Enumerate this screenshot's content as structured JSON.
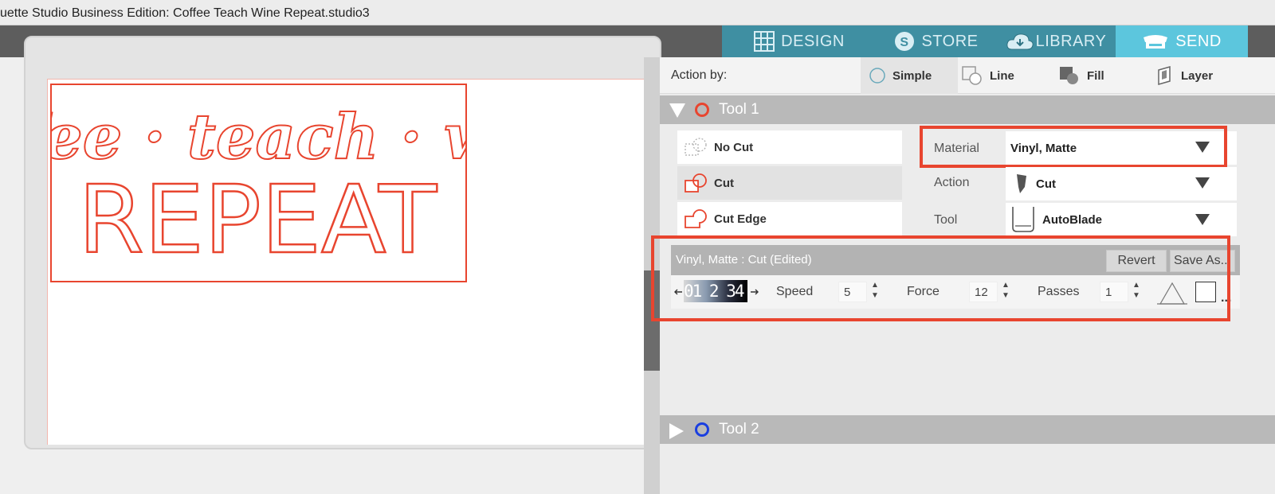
{
  "window": {
    "title": "uette Studio Business Edition: Coffee Teach Wine Repeat.studio3"
  },
  "nav": {
    "design": "DESIGN",
    "store": "STORE",
    "library": "LIBRARY",
    "send": "SEND"
  },
  "design": {
    "line1": "coffee · teach · wine",
    "line2": "REPEAT",
    "cut_color": "#e8452f"
  },
  "action_by": {
    "label": "Action by:",
    "options": [
      "Simple",
      "Line",
      "Fill",
      "Layer"
    ],
    "selected": "Simple"
  },
  "tool1": {
    "name": "Tool 1",
    "ring_color": "#e8452f",
    "cut_options": [
      "No Cut",
      "Cut",
      "Cut Edge"
    ],
    "selected_cut": "Cut",
    "material_label": "Material",
    "material_value": "Vinyl, Matte",
    "action_label": "Action",
    "action_value": "Cut",
    "tool_label": "Tool",
    "tool_value": "AutoBlade"
  },
  "settings": {
    "title": "Vinyl, Matte : Cut (Edited)",
    "revert": "Revert",
    "save_as": "Save As...",
    "blade_digits": "01 2 34",
    "speed_label": "Speed",
    "speed_value": "5",
    "force_label": "Force",
    "force_value": "12",
    "passes_label": "Passes",
    "passes_value": "1",
    "more": "..."
  },
  "tool2": {
    "name": "Tool 2",
    "ring_color": "#1a3fe0"
  }
}
